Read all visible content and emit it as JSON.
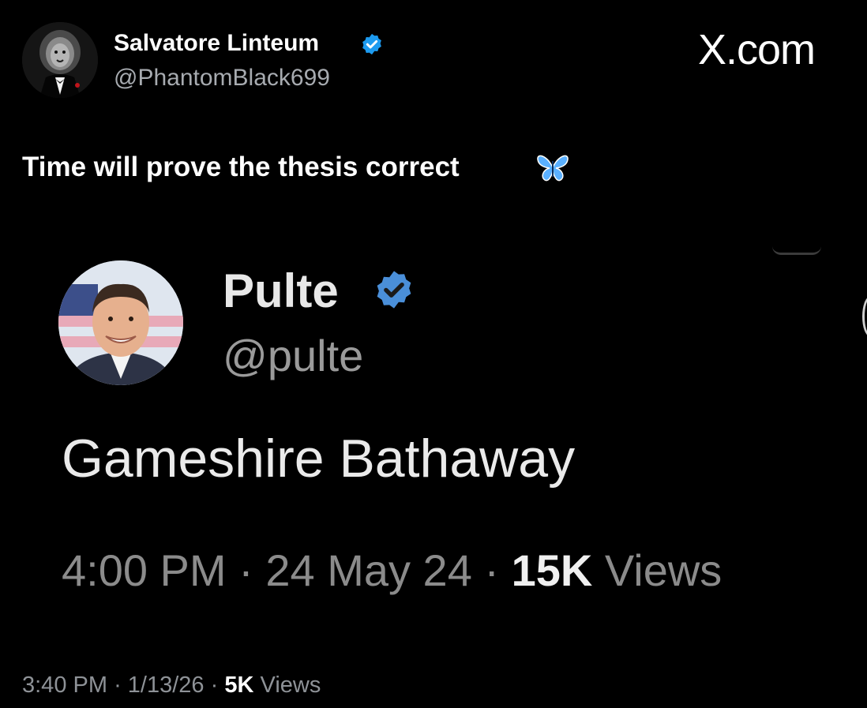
{
  "author": {
    "display_name": "Salvatore Linteum",
    "handle": "@PhantomBlack699",
    "avatar_icon": "lion-in-tuxedo-avatar",
    "verified_icon": "verified-badge-icon"
  },
  "brand": {
    "label": "X.com"
  },
  "post": {
    "text": "Time will prove the thesis correct",
    "emoji_icon": "blue-butterfly-icon"
  },
  "quoted_screenshot": {
    "display_name": "Pulte",
    "handle": "@pulte",
    "avatar_icon": "man-smiling-avatar",
    "verified_icon": "verified-badge-icon",
    "text": "Gameshire Bathaway",
    "time": "4:00 PM",
    "separator": "·",
    "date": "24 May 24",
    "views_count": "15K",
    "views_label": "Views"
  },
  "meta": {
    "time": "3:40 PM",
    "separator": "·",
    "date": "1/13/26",
    "views_count": "5K",
    "views_label": "Views"
  },
  "colors": {
    "background": "#000000",
    "verified_blue": "#1d9bf0",
    "secondary_text": "#8e9297"
  }
}
